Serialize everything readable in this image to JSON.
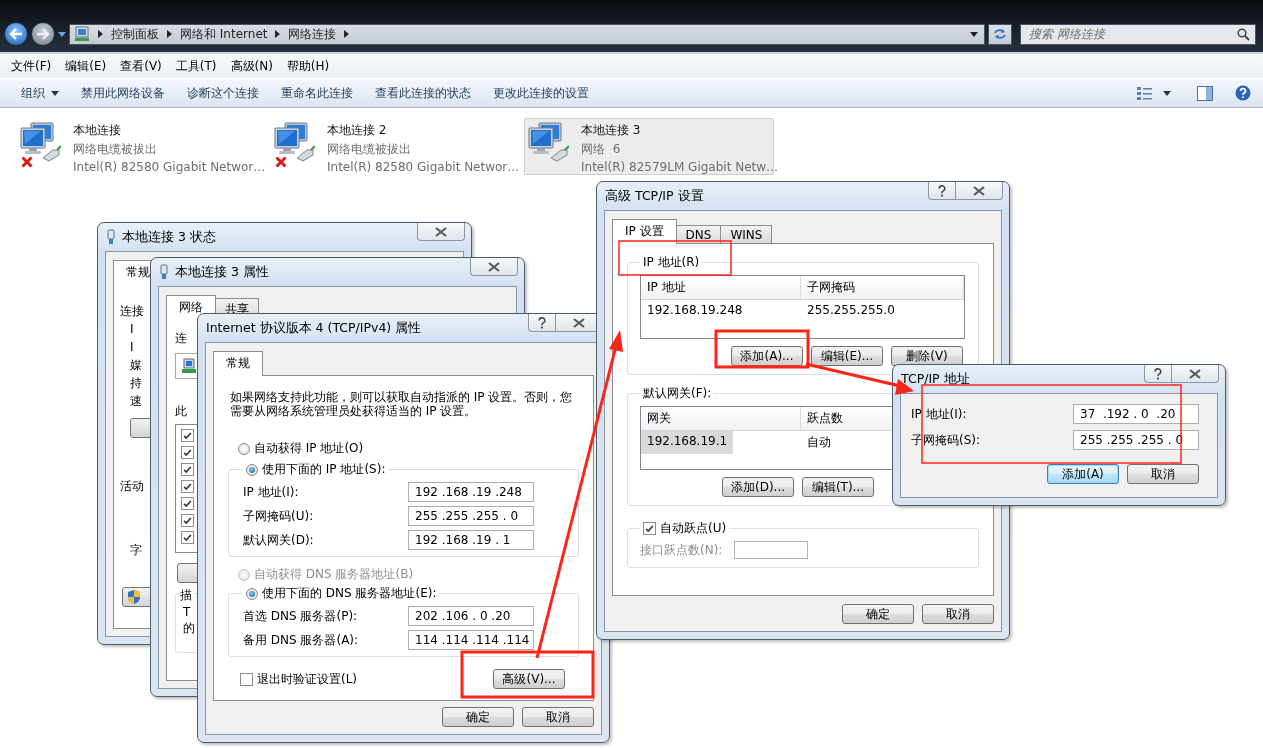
{
  "explorer": {
    "breadcrumbs": [
      "控制面板",
      "网络和 Internet",
      "网络连接"
    ],
    "search": {
      "placeholder": "搜索 网络连接"
    },
    "menu": [
      "文件(F)",
      "编辑(E)",
      "查看(V)",
      "工具(T)",
      "高级(N)",
      "帮助(H)"
    ],
    "toolbar": [
      {
        "label": "组织",
        "kind": "dropdown"
      },
      {
        "label": "禁用此网络设备",
        "kind": "action"
      },
      {
        "label": "诊断这个连接",
        "kind": "action"
      },
      {
        "label": "重命名此连接",
        "kind": "action"
      },
      {
        "label": "查看此连接的状态",
        "kind": "action"
      },
      {
        "label": "更改此连接的设置",
        "kind": "action"
      }
    ],
    "connections": [
      {
        "name": "本地连接",
        "status": "网络电缆被拔出",
        "adapter": "Intel(R) 82580 Gigabit Networ…",
        "disconnected": true,
        "selected": false
      },
      {
        "name": "本地连接 2",
        "status": "网络电缆被拔出",
        "adapter": "Intel(R) 82580 Gigabit Networ…",
        "disconnected": true,
        "selected": false
      },
      {
        "name": "本地连接 3",
        "status": "网络  6",
        "adapter": "Intel(R) 82579LM Gigabit Netw…",
        "disconnected": false,
        "selected": true
      }
    ]
  },
  "status_dialog": {
    "title": "本地连接 3 状态",
    "tabs": [
      {
        "label": "常规",
        "selected": true
      }
    ],
    "labels": [
      {
        "text": "连接",
        "kind": "heading"
      },
      {
        "text": "I",
        "kind": "item"
      },
      {
        "text": "I",
        "kind": "item"
      },
      {
        "text": "媒",
        "kind": "item"
      },
      {
        "text": "持",
        "kind": "item"
      },
      {
        "text": "速",
        "kind": "item"
      },
      {
        "kind": "button"
      },
      {
        "text": "活动",
        "kind": "heading"
      },
      {
        "text": "字",
        "kind": "item"
      },
      {
        "kind": "shield_button"
      }
    ]
  },
  "properties_dialog": {
    "title": "本地连接 3 属性",
    "tabs": [
      {
        "label": "网络",
        "selected": true
      },
      {
        "label": "共享",
        "selected": false
      }
    ],
    "connect_label": "连",
    "items_label": "此",
    "components": [
      {
        "checked": true
      },
      {
        "checked": true
      },
      {
        "checked": true
      },
      {
        "checked": true
      },
      {
        "checked": true
      },
      {
        "checked": true
      },
      {
        "checked": true
      }
    ],
    "description_label": "描",
    "description_lines": [
      "T",
      "的"
    ]
  },
  "ipv4_dialog": {
    "title": "Internet 协议版本 4 (TCP/IPv4) 属性",
    "tabs": [
      {
        "label": "常规",
        "selected": true
      }
    ],
    "intro": "如果网络支持此功能，则可以获取自动指派的 IP 设置。否则，您需要从网络系统管理员处获得适当的 IP 设置。",
    "ip_modes": [
      {
        "label": "自动获得 IP 地址(O)",
        "selected": false,
        "disabled": false
      },
      {
        "label": "使用下面的 IP 地址(S):",
        "selected": true,
        "disabled": false
      }
    ],
    "ip_fields": [
      {
        "label": "IP 地址(I):",
        "value": "192 .168 .19 .248"
      },
      {
        "label": "子网掩码(U):",
        "value": "255 .255 .255 . 0"
      },
      {
        "label": "默认网关(D):",
        "value": "192 .168 .19 . 1"
      }
    ],
    "dns_modes": [
      {
        "label": "自动获得 DNS 服务器地址(B)",
        "selected": false,
        "disabled": true
      },
      {
        "label": "使用下面的 DNS 服务器地址(E):",
        "selected": true,
        "disabled": false
      }
    ],
    "dns_fields": [
      {
        "label": "首选 DNS 服务器(P):",
        "value": "202 .106 . 0 .20"
      },
      {
        "label": "备用 DNS 服务器(A):",
        "value": "114 .114 .114 .114"
      }
    ],
    "validate": {
      "label": "退出时验证设置(L)",
      "checked": false
    },
    "advanced_button": "高级(V)...",
    "buttons": [
      "确定",
      "取消"
    ]
  },
  "advanced_dialog": {
    "title": "高级 TCP/IP 设置",
    "tabs": [
      {
        "label": "IP 设置",
        "selected": true
      },
      {
        "label": "DNS",
        "selected": false
      },
      {
        "label": "WINS",
        "selected": false
      }
    ],
    "ip_group": {
      "title": "IP 地址(R)",
      "columns": [
        "IP 地址",
        "子网掩码"
      ],
      "rows": [
        {
          "cells": [
            "192.168.19.248",
            "255.255.255.0"
          ],
          "selected": false
        }
      ],
      "buttons": [
        "添加(A)...",
        "编辑(E)...",
        "删除(V)"
      ]
    },
    "gateway_group": {
      "title": "默认网关(F):",
      "columns": [
        "网关",
        "跃点数"
      ],
      "rows": [
        {
          "cells": [
            "192.168.19.1",
            "自动"
          ],
          "selected": true
        }
      ],
      "buttons": [
        "添加(D)...",
        "编辑(T)..."
      ]
    },
    "auto_metric": {
      "label": "自动跃点(U)",
      "checked": true
    },
    "metric": {
      "label": "接口跃点数(N):",
      "disabled": true
    },
    "buttons": [
      "确定",
      "取消"
    ]
  },
  "address_dialog": {
    "title": "TCP/IP 地址",
    "fields": [
      {
        "label": "IP 地址(I):",
        "value": "37  .192 . 0  .20"
      },
      {
        "label": "子网掩码(S):",
        "value": "255 .255 .255 . 0"
      }
    ],
    "buttons": [
      {
        "label": "添加(A)",
        "default": true
      },
      {
        "label": "取消",
        "default": false
      }
    ]
  }
}
